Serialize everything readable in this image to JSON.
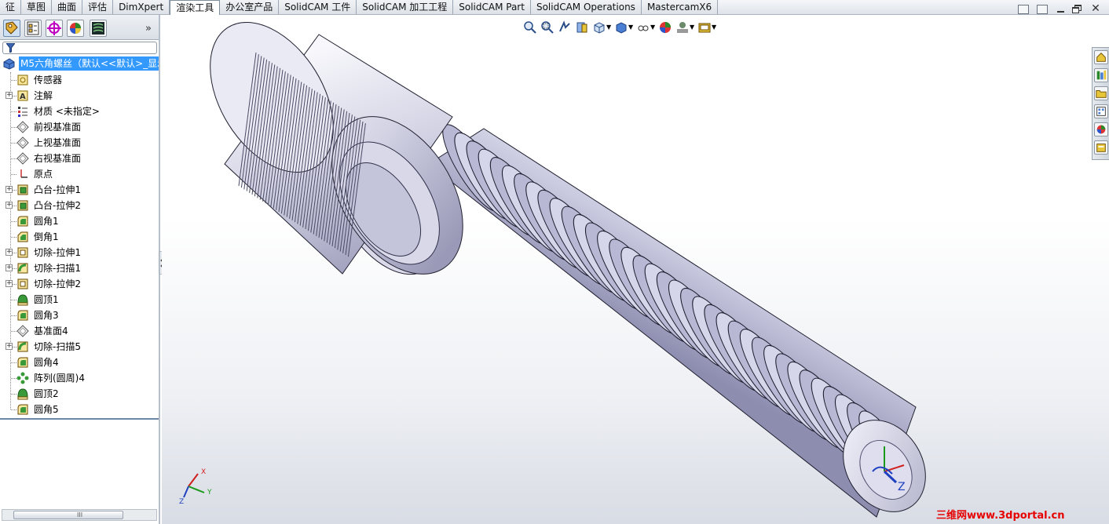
{
  "tabs": [
    {
      "label": "征",
      "active": false
    },
    {
      "label": "草图",
      "active": false
    },
    {
      "label": "曲面",
      "active": false
    },
    {
      "label": "评估",
      "active": false
    },
    {
      "label": "DimXpert",
      "active": false
    },
    {
      "label": "渲染工具",
      "active": true
    },
    {
      "label": "办公室产品",
      "active": false
    },
    {
      "label": "SolidCAM 工件",
      "active": false
    },
    {
      "label": "SolidCAM 加工工程",
      "active": false
    },
    {
      "label": "SolidCAM Part",
      "active": false
    },
    {
      "label": "SolidCAM Operations",
      "active": false
    },
    {
      "label": "MastercamX6",
      "active": false
    }
  ],
  "panel": {
    "toolbar_icons": [
      "feature-manager-icon",
      "property-manager-icon",
      "configuration-manager-icon",
      "display-manager-icon",
      "layers-icon"
    ],
    "expand_glyph": "»",
    "root_label": "M5六角螺丝（默认<<默认>_显示",
    "scroll_grip": "III",
    "items": [
      {
        "label": "传感器",
        "icon": "sensor-icon",
        "expandable": false
      },
      {
        "label": "注解",
        "icon": "annotation-icon",
        "expandable": true
      },
      {
        "label": "材质 <未指定>",
        "icon": "material-icon",
        "expandable": false
      },
      {
        "label": "前视基准面",
        "icon": "plane-icon",
        "expandable": false
      },
      {
        "label": "上视基准面",
        "icon": "plane-icon",
        "expandable": false
      },
      {
        "label": "右视基准面",
        "icon": "plane-icon",
        "expandable": false
      },
      {
        "label": "原点",
        "icon": "origin-icon",
        "expandable": false
      },
      {
        "label": "凸台-拉伸1",
        "icon": "boss-extrude-icon",
        "expandable": true
      },
      {
        "label": "凸台-拉伸2",
        "icon": "boss-extrude-icon",
        "expandable": true
      },
      {
        "label": "圆角1",
        "icon": "fillet-icon",
        "expandable": false
      },
      {
        "label": "倒角1",
        "icon": "chamfer-icon",
        "expandable": false
      },
      {
        "label": "切除-拉伸1",
        "icon": "cut-extrude-icon",
        "expandable": true
      },
      {
        "label": "切除-扫描1",
        "icon": "cut-sweep-icon",
        "expandable": true
      },
      {
        "label": "切除-拉伸2",
        "icon": "cut-extrude-icon",
        "expandable": true
      },
      {
        "label": "圆顶1",
        "icon": "dome-icon",
        "expandable": false
      },
      {
        "label": "圆角3",
        "icon": "fillet-icon",
        "expandable": false
      },
      {
        "label": "基准面4",
        "icon": "plane-icon",
        "expandable": false
      },
      {
        "label": "切除-扫描5",
        "icon": "cut-sweep-icon",
        "expandable": true
      },
      {
        "label": "圆角4",
        "icon": "fillet-icon",
        "expandable": false
      },
      {
        "label": "阵列(圆周)4",
        "icon": "circular-pattern-icon",
        "expandable": false
      },
      {
        "label": "圆顶2",
        "icon": "dome-icon",
        "expandable": false
      },
      {
        "label": "圆角5",
        "icon": "fillet-icon",
        "expandable": false
      }
    ]
  },
  "triad": {
    "x": "X",
    "y": "Y",
    "z": "Z"
  },
  "model_triad": {
    "z": "Z"
  },
  "watermark": "三维网www.3dportal.cn",
  "colors": {
    "selection": "#3399ff",
    "watermark": "#e60000",
    "model": "#c8c8dc"
  }
}
